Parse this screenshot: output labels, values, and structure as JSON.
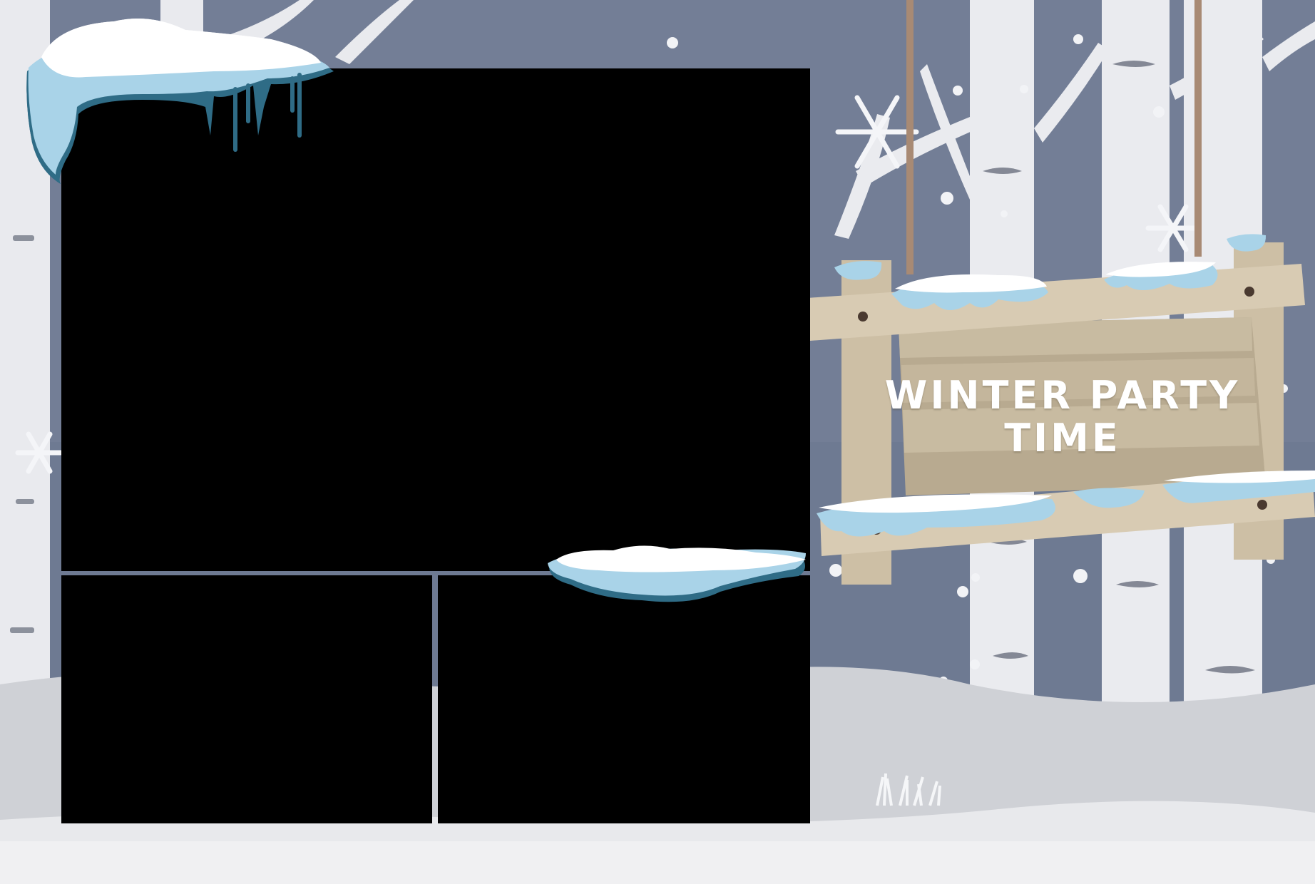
{
  "sign": {
    "line1": "WINTER PARTY",
    "line2": "TIME"
  },
  "colors": {
    "sky": "#6c7891",
    "sky_dark": "#5d6a84",
    "birch": "#e7e8ec",
    "birch_shadow": "#c9ccd3",
    "snow_ground": "#e4e5e8",
    "ice_blue": "#a9d3e8",
    "ice_dark": "#2f6c86",
    "wood_light": "#d9ccb5",
    "wood_dark": "#bfb197",
    "rope": "#a88a74"
  },
  "photo_slots": [
    {
      "name": "main"
    },
    {
      "name": "bottom-left"
    },
    {
      "name": "bottom-right"
    }
  ]
}
